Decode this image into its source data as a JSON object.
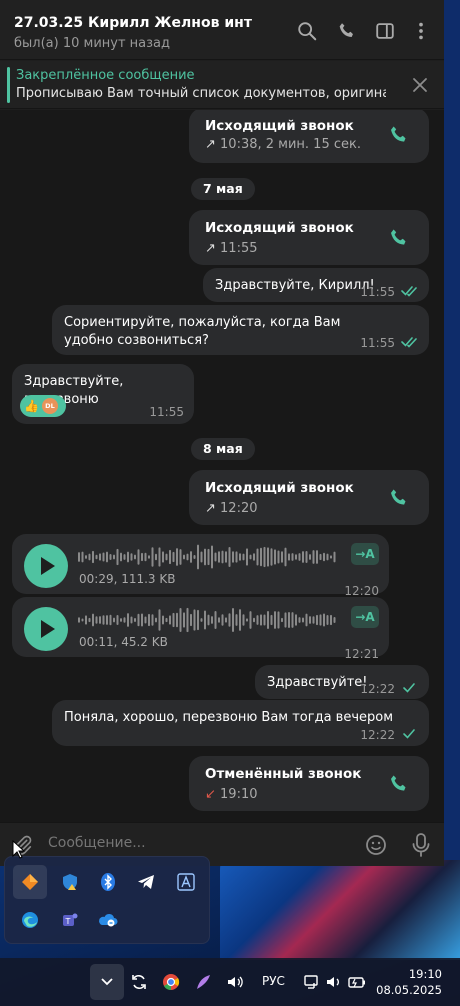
{
  "header": {
    "title": "27.03.25 Кирилл Желнов инт",
    "status": "был(а) 10 минут назад"
  },
  "pinned": {
    "title": "Закреплённое сообщение",
    "text": "Прописываю Вам точный список документов, оригинал..."
  },
  "messages": {
    "call1": {
      "title": "Исходящий звонок",
      "meta": "10:38, 2 мин. 15 сек."
    },
    "date1": "7 мая",
    "call2": {
      "title": "Исходящий звонок",
      "meta": "11:55"
    },
    "m1": {
      "text": "Здравствуйте, Кирилл!",
      "time": "11:55"
    },
    "m2": {
      "text": "Сориентируйте, пожалуйста, когда Вам удобно созвониться?",
      "time": "11:55"
    },
    "m3": {
      "text": "Здравствуйте, перезвоню",
      "time": "11:55",
      "reaction": "👍",
      "reaction_avatar": "DL"
    },
    "date2": "8 мая",
    "call3": {
      "title": "Исходящий звонок",
      "meta": "12:20"
    },
    "v1": {
      "meta": "00:29, 111.3 KB",
      "time": "12:20",
      "transcribe": "→A"
    },
    "v2": {
      "meta": "00:11, 45.2 KB",
      "time": "12:21",
      "transcribe": "→A"
    },
    "m4": {
      "text": "Здравствуйте!",
      "time": "12:22"
    },
    "m5": {
      "text": "Поняла, хорошо, перезвоню Вам тогда вечером",
      "time": "12:22"
    },
    "call4": {
      "title": "Отменённый звонок",
      "meta": "19:10"
    }
  },
  "composer": {
    "placeholder": "Сообщение..."
  },
  "taskbar": {
    "lang": "РУС",
    "time": "19:10",
    "date": "08.05.2025"
  },
  "colors": {
    "accent": "#4fc3a1",
    "missed": "#e0584a",
    "bubble": "#2a2b2d"
  }
}
